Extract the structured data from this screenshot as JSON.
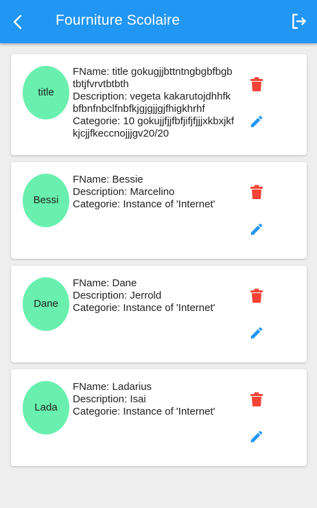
{
  "appbar": {
    "title": "Fourniture Scolaire",
    "back_icon": "arrow-back-icon",
    "logout_icon": "logout-icon",
    "color": "#2196f3"
  },
  "items": [
    {
      "avatar_text": "title",
      "fname": "FName: title gokugjjbttntngbgbfbgbtbtjfvrvtbtbth",
      "description": "Description: vegeta kakarutojdhhfkbfbnfnbclfnbfkjgjgjjgjfhigkhrhf",
      "categorie": "Categorie: 10 gokujjfjjfbfjifjfjjjxkbxjkfkjcjjfkeccnojjjgv20/20"
    },
    {
      "avatar_text": "Bessi",
      "fname": "FName: Bessie",
      "description": "Description: Marcelino",
      "categorie": "Categorie: Instance of 'Internet'"
    },
    {
      "avatar_text": "Dane",
      "fname": "FName: Dane",
      "description": "Description: Jerrold",
      "categorie": "Categorie: Instance of 'Internet'"
    },
    {
      "avatar_text": "Lada",
      "fname": "FName: Ladarius",
      "description": "Description: Isai",
      "categorie": "Categorie: Instance of 'Internet'"
    }
  ],
  "colors": {
    "avatar": "#69f0ae",
    "delete": "#f44336",
    "edit": "#2196f3"
  },
  "icons": {
    "delete": "delete-icon",
    "edit": "edit-icon"
  }
}
